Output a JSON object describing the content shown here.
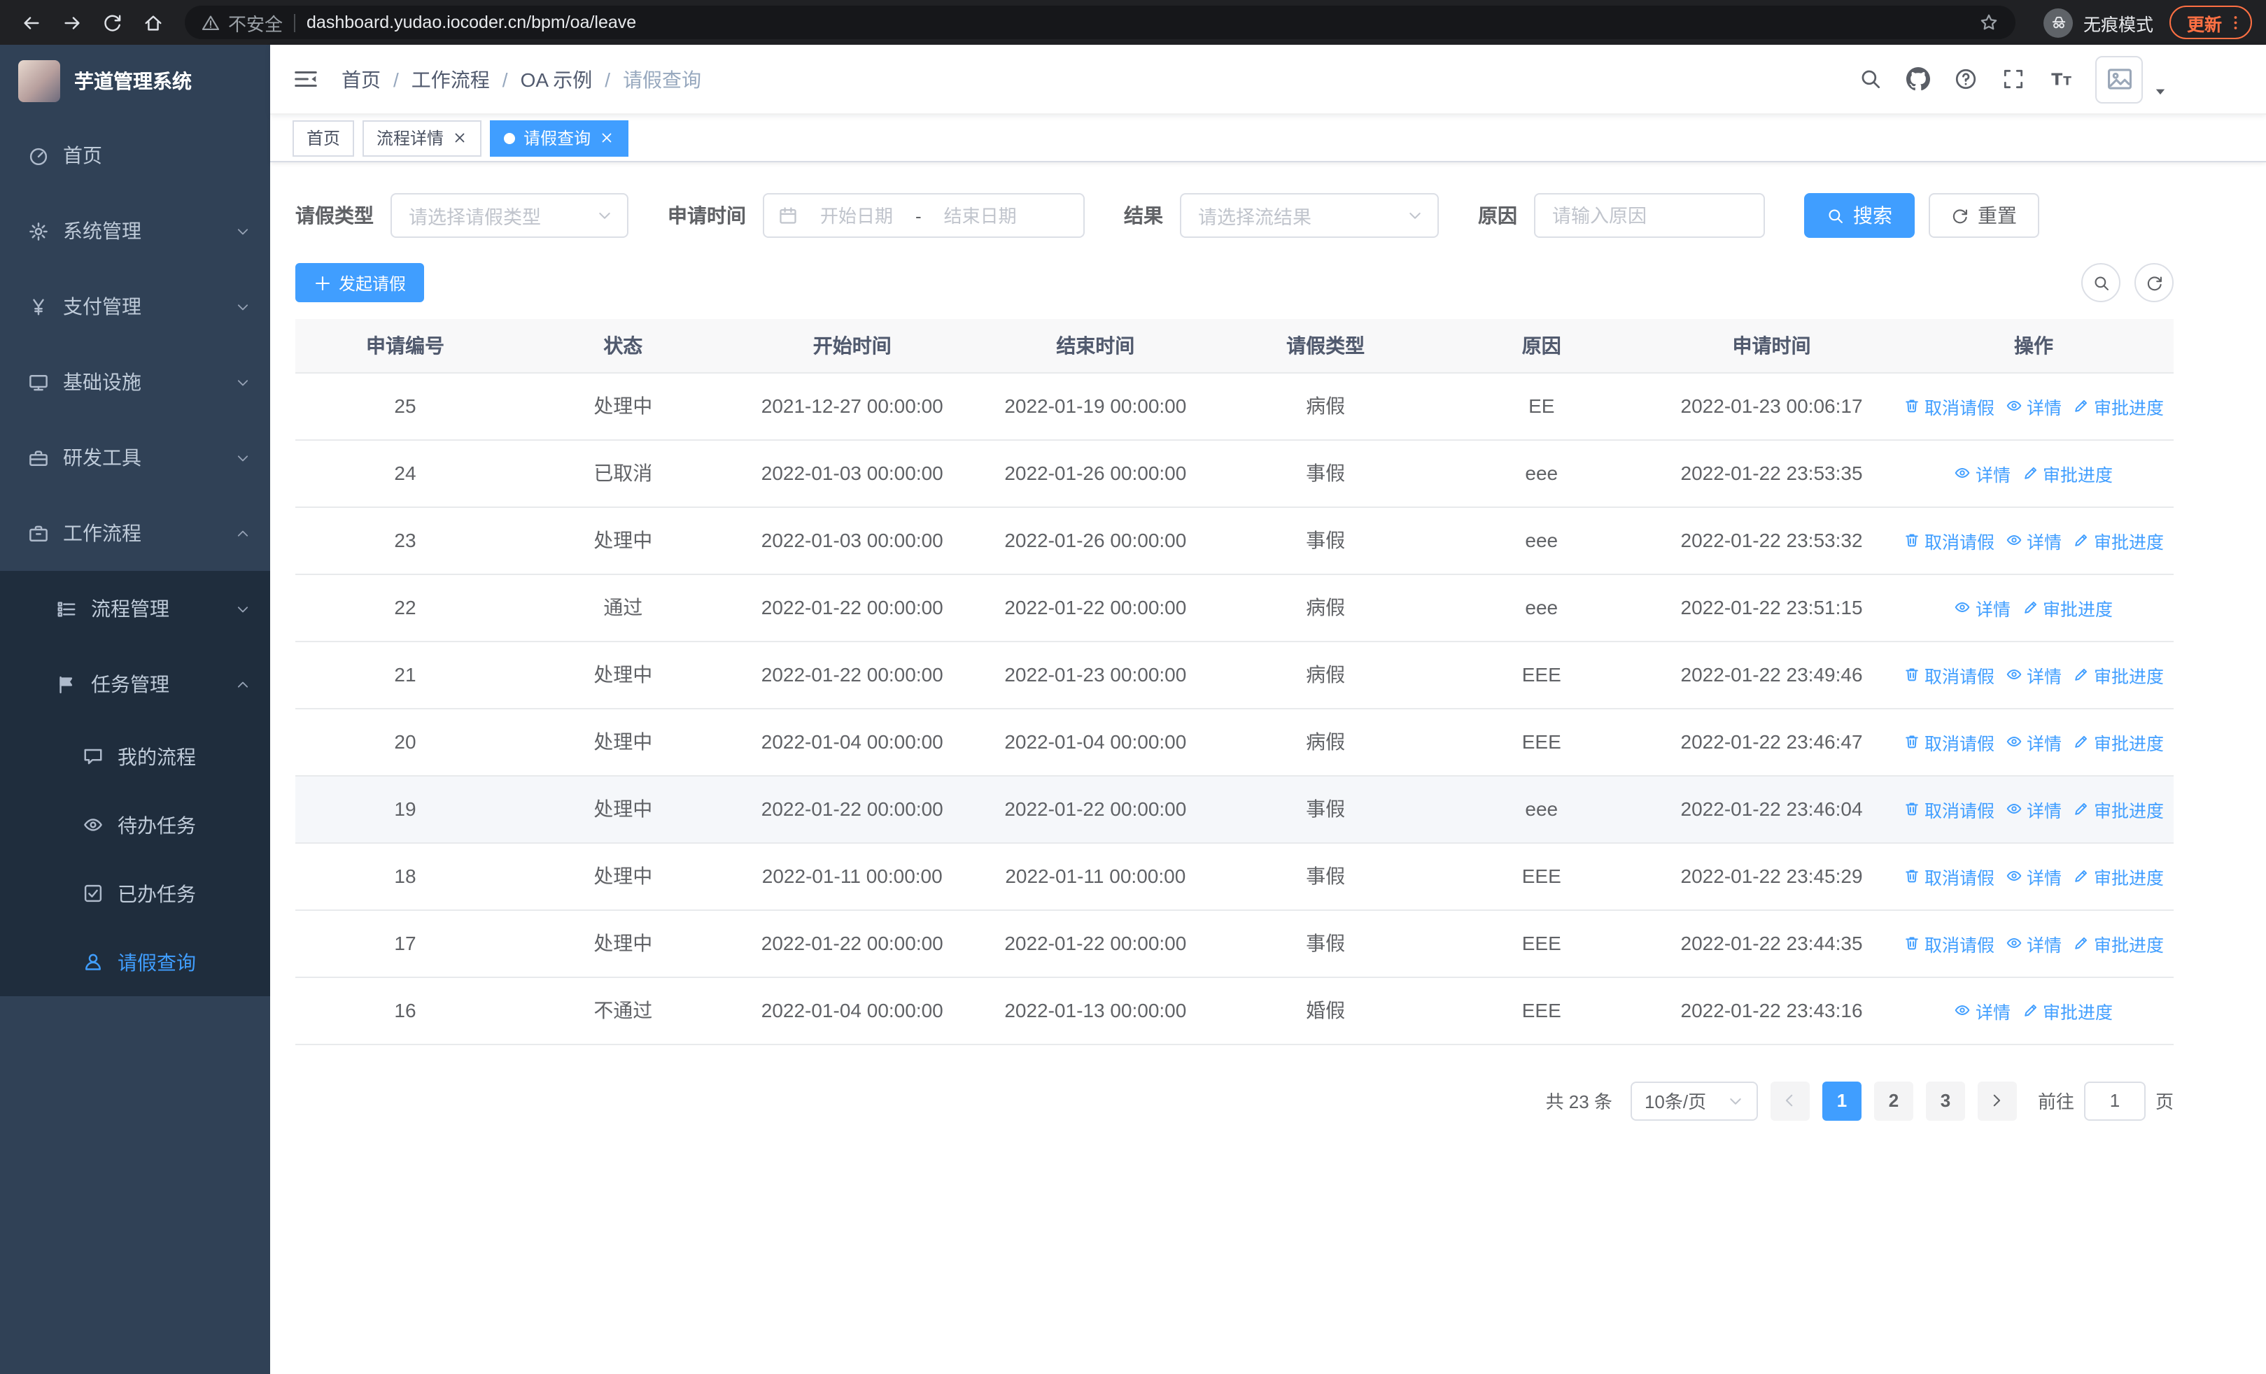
{
  "colors": {
    "primary": "#409eff",
    "sidebar_bg": "#304156",
    "sidebar_submenu_bg": "#1f2d3d",
    "update_accent": "#ff7043"
  },
  "browser": {
    "nav_buttons": [
      {
        "id": "back",
        "icon": "arrow-left-icon"
      },
      {
        "id": "forward",
        "icon": "arrow-right-icon"
      },
      {
        "id": "reload",
        "icon": "reload-icon"
      },
      {
        "id": "home",
        "icon": "home-icon"
      }
    ],
    "security_label": "不安全",
    "url": "dashboard.yudao.iocoder.cn/bpm/oa/leave",
    "incognito_label": "无痕模式",
    "update_label": "更新"
  },
  "sidebar": {
    "logo_title": "芋道管理系统",
    "top_items": [
      {
        "id": "home",
        "label": "首页",
        "icon": "dashboard-icon"
      },
      {
        "id": "system",
        "label": "系统管理",
        "icon": "gear-icon",
        "chevron": "down"
      },
      {
        "id": "payment",
        "label": "支付管理",
        "icon": "yen-icon",
        "chevron": "down"
      },
      {
        "id": "infra",
        "label": "基础设施",
        "icon": "monitor-icon",
        "chevron": "down"
      },
      {
        "id": "devtools",
        "label": "研发工具",
        "icon": "toolbox-icon",
        "chevron": "down"
      },
      {
        "id": "workflow",
        "label": "工作流程",
        "icon": "briefcase-icon",
        "chevron": "up",
        "expanded": true
      }
    ],
    "workflow_children": [
      {
        "id": "process-mgmt",
        "label": "流程管理",
        "icon": "flow-icon",
        "chevron": "down"
      },
      {
        "id": "task-mgmt",
        "label": "任务管理",
        "icon": "flag-icon",
        "chevron": "up",
        "expanded": true,
        "children": [
          {
            "id": "my-process",
            "label": "我的流程",
            "icon": "comment-icon"
          },
          {
            "id": "todo-tasks",
            "label": "待办任务",
            "icon": "eye-icon"
          },
          {
            "id": "done-tasks",
            "label": "已办任务",
            "icon": "check-icon"
          },
          {
            "id": "leave-query",
            "label": "请假查询",
            "icon": "user-icon",
            "active": true
          }
        ]
      }
    ]
  },
  "header": {
    "breadcrumb": [
      "首页",
      "工作流程",
      "OA 示例",
      "请假查询"
    ],
    "breadcrumb_separator": "/",
    "icons": [
      {
        "id": "search",
        "icon": "search-icon"
      },
      {
        "id": "github",
        "icon": "github-icon"
      },
      {
        "id": "help",
        "icon": "question-icon"
      },
      {
        "id": "fullscreen",
        "icon": "fullscreen-icon"
      },
      {
        "id": "font-size",
        "icon": "font-size-icon"
      }
    ]
  },
  "tabs": [
    {
      "id": "home",
      "label": "首页",
      "closable": false,
      "active": false
    },
    {
      "id": "process-detail",
      "label": "流程详情",
      "closable": true,
      "active": false
    },
    {
      "id": "leave-query",
      "label": "请假查询",
      "closable": true,
      "active": true
    }
  ],
  "filters": {
    "leave_type_label": "请假类型",
    "leave_type_placeholder": "请选择请假类型",
    "apply_time_label": "申请时间",
    "start_date_placeholder": "开始日期",
    "range_separator": "-",
    "end_date_placeholder": "结束日期",
    "result_label": "结果",
    "result_placeholder": "请选择流结果",
    "reason_label": "原因",
    "reason_placeholder": "请输入原因",
    "search_label": "搜索",
    "reset_label": "重置"
  },
  "toolbar": {
    "create_label": "发起请假",
    "icon_buttons": [
      {
        "id": "toggle-search",
        "icon": "search-icon"
      },
      {
        "id": "refresh",
        "icon": "refresh-icon"
      }
    ]
  },
  "table": {
    "columns": [
      "申请编号",
      "状态",
      "开始时间",
      "结束时间",
      "请假类型",
      "原因",
      "申请时间",
      "操作"
    ],
    "action_defs": {
      "cancel": {
        "label": "取消请假",
        "icon": "trash-icon"
      },
      "detail": {
        "label": "详情",
        "icon": "eye-icon"
      },
      "progress": {
        "label": "审批进度",
        "icon": "edit-icon"
      }
    },
    "rows": [
      {
        "no": "25",
        "status": "处理中",
        "start_time": "2021-12-27 00:00:00",
        "end_time": "2022-01-19 00:00:00",
        "leave_type": "病假",
        "reason": "EE",
        "apply_time": "2022-01-23 00:06:17",
        "actions": [
          "cancel",
          "detail",
          "progress"
        ],
        "highlight": false
      },
      {
        "no": "24",
        "status": "已取消",
        "start_time": "2022-01-03 00:00:00",
        "end_time": "2022-01-26 00:00:00",
        "leave_type": "事假",
        "reason": "eee",
        "apply_time": "2022-01-22 23:53:35",
        "actions": [
          "detail",
          "progress"
        ],
        "highlight": false
      },
      {
        "no": "23",
        "status": "处理中",
        "start_time": "2022-01-03 00:00:00",
        "end_time": "2022-01-26 00:00:00",
        "leave_type": "事假",
        "reason": "eee",
        "apply_time": "2022-01-22 23:53:32",
        "actions": [
          "cancel",
          "detail",
          "progress"
        ],
        "highlight": false
      },
      {
        "no": "22",
        "status": "通过",
        "start_time": "2022-01-22 00:00:00",
        "end_time": "2022-01-22 00:00:00",
        "leave_type": "病假",
        "reason": "eee",
        "apply_time": "2022-01-22 23:51:15",
        "actions": [
          "detail",
          "progress"
        ],
        "highlight": false
      },
      {
        "no": "21",
        "status": "处理中",
        "start_time": "2022-01-22 00:00:00",
        "end_time": "2022-01-23 00:00:00",
        "leave_type": "病假",
        "reason": "EEE",
        "apply_time": "2022-01-22 23:49:46",
        "actions": [
          "cancel",
          "detail",
          "progress"
        ],
        "highlight": false
      },
      {
        "no": "20",
        "status": "处理中",
        "start_time": "2022-01-04 00:00:00",
        "end_time": "2022-01-04 00:00:00",
        "leave_type": "病假",
        "reason": "EEE",
        "apply_time": "2022-01-22 23:46:47",
        "actions": [
          "cancel",
          "detail",
          "progress"
        ],
        "highlight": false
      },
      {
        "no": "19",
        "status": "处理中",
        "start_time": "2022-01-22 00:00:00",
        "end_time": "2022-01-22 00:00:00",
        "leave_type": "事假",
        "reason": "eee",
        "apply_time": "2022-01-22 23:46:04",
        "actions": [
          "cancel",
          "detail",
          "progress"
        ],
        "highlight": true
      },
      {
        "no": "18",
        "status": "处理中",
        "start_time": "2022-01-11 00:00:00",
        "end_time": "2022-01-11 00:00:00",
        "leave_type": "事假",
        "reason": "EEE",
        "apply_time": "2022-01-22 23:45:29",
        "actions": [
          "cancel",
          "detail",
          "progress"
        ],
        "highlight": false
      },
      {
        "no": "17",
        "status": "处理中",
        "start_time": "2022-01-22 00:00:00",
        "end_time": "2022-01-22 00:00:00",
        "leave_type": "事假",
        "reason": "EEE",
        "apply_time": "2022-01-22 23:44:35",
        "actions": [
          "cancel",
          "detail",
          "progress"
        ],
        "highlight": false
      },
      {
        "no": "16",
        "status": "不通过",
        "start_time": "2022-01-04 00:00:00",
        "end_time": "2022-01-13 00:00:00",
        "leave_type": "婚假",
        "reason": "EEE",
        "apply_time": "2022-01-22 23:43:16",
        "actions": [
          "detail",
          "progress"
        ],
        "highlight": false
      }
    ]
  },
  "pagination": {
    "total_label": "共 23 条",
    "page_size_label": "10条/页",
    "pages": [
      "1",
      "2",
      "3"
    ],
    "active_page": "1",
    "goto_label": "前往",
    "goto_value": "1",
    "goto_suffix": "页"
  }
}
